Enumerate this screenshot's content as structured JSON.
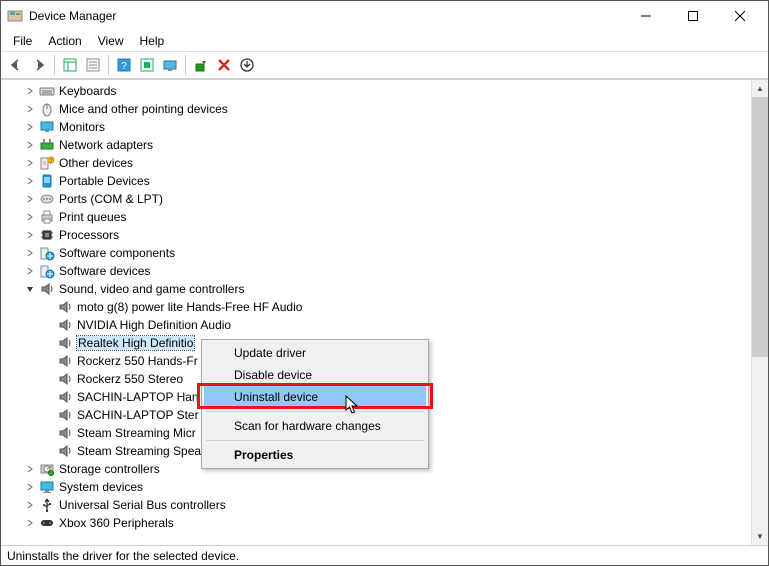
{
  "title": "Device Manager",
  "menubar": [
    "File",
    "Action",
    "View",
    "Help"
  ],
  "statusbar": "Uninstalls the driver for the selected device.",
  "context_menu": {
    "items": [
      {
        "label": "Update driver",
        "highlight": false
      },
      {
        "label": "Disable device",
        "highlight": false
      },
      {
        "label": "Uninstall device",
        "highlight": true
      },
      {
        "sep": true
      },
      {
        "label": "Scan for hardware changes",
        "highlight": false
      },
      {
        "sep": true
      },
      {
        "label": "Properties",
        "highlight": false,
        "bold": true
      }
    ]
  },
  "tree": [
    {
      "label": "Keyboards",
      "icon": "keyboard",
      "level": 0,
      "chev": "right"
    },
    {
      "label": "Mice and other pointing devices",
      "icon": "mouse",
      "level": 0,
      "chev": "right"
    },
    {
      "label": "Monitors",
      "icon": "monitor",
      "level": 0,
      "chev": "right"
    },
    {
      "label": "Network adapters",
      "icon": "network",
      "level": 0,
      "chev": "right"
    },
    {
      "label": "Other devices",
      "icon": "other",
      "level": 0,
      "chev": "right"
    },
    {
      "label": "Portable Devices",
      "icon": "portable",
      "level": 0,
      "chev": "right"
    },
    {
      "label": "Ports (COM & LPT)",
      "icon": "port",
      "level": 0,
      "chev": "right"
    },
    {
      "label": "Print queues",
      "icon": "printer",
      "level": 0,
      "chev": "right"
    },
    {
      "label": "Processors",
      "icon": "cpu",
      "level": 0,
      "chev": "right"
    },
    {
      "label": "Software components",
      "icon": "software",
      "level": 0,
      "chev": "right"
    },
    {
      "label": "Software devices",
      "icon": "software",
      "level": 0,
      "chev": "right"
    },
    {
      "label": "Sound, video and game controllers",
      "icon": "sound",
      "level": 0,
      "chev": "down"
    },
    {
      "label": "moto g(8) power lite Hands-Free HF Audio",
      "icon": "sound",
      "level": 1,
      "chev": "none"
    },
    {
      "label": "NVIDIA High Definition Audio",
      "icon": "sound",
      "level": 1,
      "chev": "none"
    },
    {
      "label": "Realtek High Definitio",
      "icon": "sound",
      "level": 1,
      "chev": "none",
      "selected": true
    },
    {
      "label": "Rockerz 550 Hands-Fr",
      "icon": "sound",
      "level": 1,
      "chev": "none"
    },
    {
      "label": "Rockerz 550 Stereo",
      "icon": "sound",
      "level": 1,
      "chev": "none"
    },
    {
      "label": "SACHIN-LAPTOP Han",
      "icon": "sound",
      "level": 1,
      "chev": "none"
    },
    {
      "label": "SACHIN-LAPTOP Ster",
      "icon": "sound",
      "level": 1,
      "chev": "none"
    },
    {
      "label": "Steam Streaming Micr",
      "icon": "sound",
      "level": 1,
      "chev": "none"
    },
    {
      "label": "Steam Streaming Spea",
      "icon": "sound",
      "level": 1,
      "chev": "none"
    },
    {
      "label": "Storage controllers",
      "icon": "storage",
      "level": 0,
      "chev": "right"
    },
    {
      "label": "System devices",
      "icon": "system",
      "level": 0,
      "chev": "right"
    },
    {
      "label": "Universal Serial Bus controllers",
      "icon": "usb",
      "level": 0,
      "chev": "right"
    },
    {
      "label": "Xbox 360 Peripherals",
      "icon": "xbox",
      "level": 0,
      "chev": "right"
    }
  ]
}
